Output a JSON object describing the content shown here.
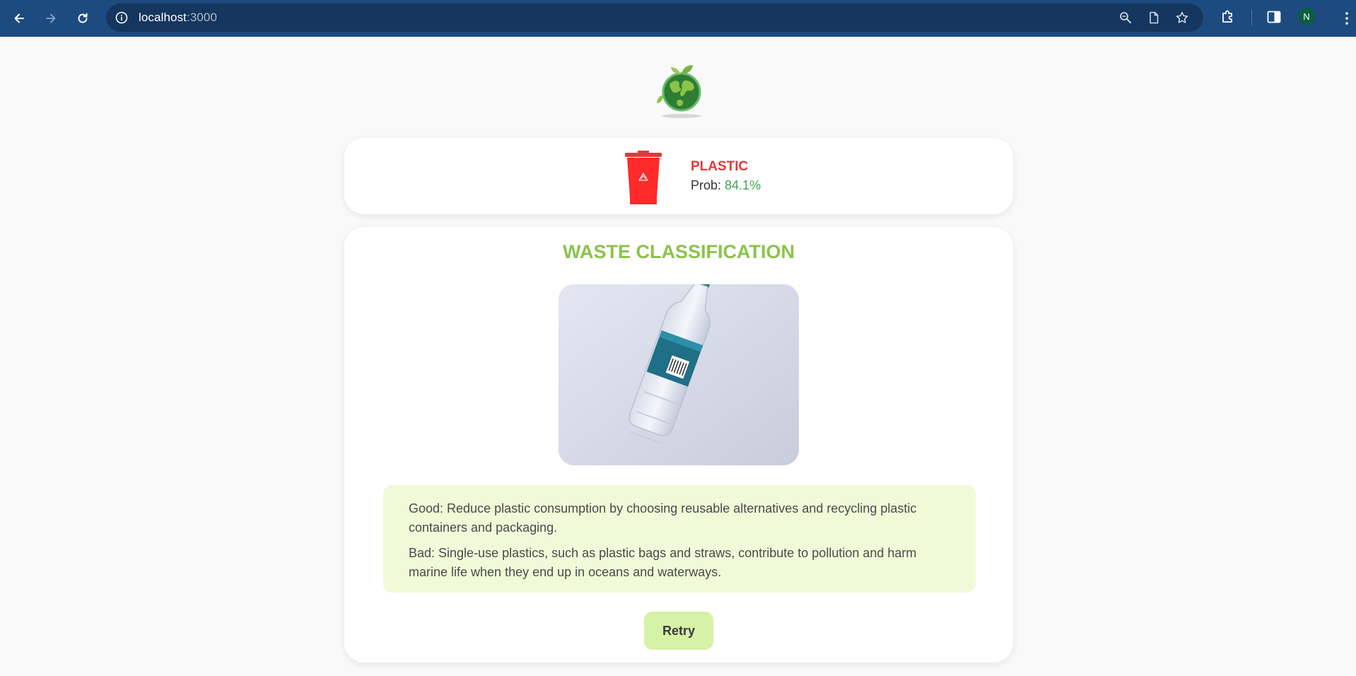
{
  "browser": {
    "url_host": "localhost",
    "url_port": ":3000",
    "profile_initial": "N",
    "icons": [
      "back-icon",
      "forward-icon",
      "reload-icon",
      "info-icon",
      "zoom-icon",
      "reader-icon",
      "bookmark-star-icon",
      "extensions-icon",
      "side-panel-icon"
    ]
  },
  "result": {
    "label": "PLASTIC",
    "prob_label": "Prob: ",
    "prob_value": "84.1%",
    "label_color": "#e53935",
    "prob_color": "#3aa655"
  },
  "main": {
    "title": "WASTE CLASSIFICATION",
    "good_text": "Good: Reduce plastic consumption by choosing reusable alternatives and recycling plastic containers and packaging.",
    "bad_text": "Bad: Single-use plastics, such as plastic bags and straws, contribute to pollution and harm marine life when they end up in oceans and waterways.",
    "retry_label": "Retry",
    "accent_color": "#8bc34a"
  }
}
